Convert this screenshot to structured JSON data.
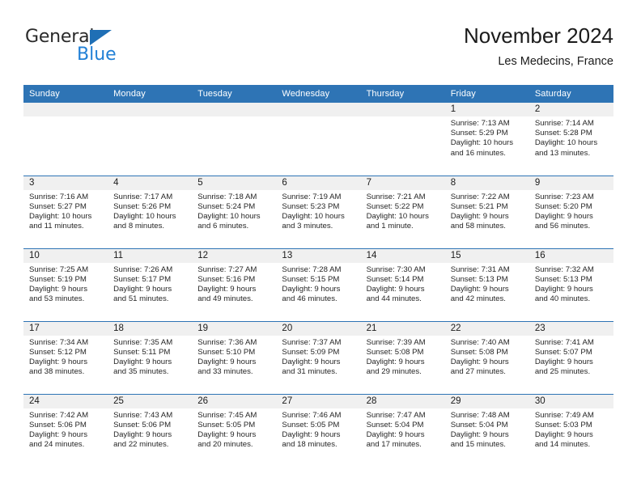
{
  "brand": {
    "name_top": "General",
    "name_bottom": "Blue",
    "triangle_color": "#1f6fb5",
    "blue_text_color": "#2180d6"
  },
  "header": {
    "month_title": "November 2024",
    "location": "Les Medecins, France"
  },
  "theme": {
    "header_blue": "#2e74b5",
    "daynum_band": "#f0f0f0",
    "text": "#262626"
  },
  "weekday_headers": [
    "Sunday",
    "Monday",
    "Tuesday",
    "Wednesday",
    "Thursday",
    "Friday",
    "Saturday"
  ],
  "labels": {
    "sunrise_prefix": "Sunrise:",
    "sunset_prefix": "Sunset:",
    "daylight_prefix": "Daylight:"
  },
  "weeks": [
    [
      {
        "day": "",
        "empty": true
      },
      {
        "day": "",
        "empty": true
      },
      {
        "day": "",
        "empty": true
      },
      {
        "day": "",
        "empty": true
      },
      {
        "day": "",
        "empty": true
      },
      {
        "day": "1",
        "sunrise": "Sunrise: 7:13 AM",
        "sunset": "Sunset: 5:29 PM",
        "daylight_line1": "Daylight: 10 hours",
        "daylight_line2": "and 16 minutes."
      },
      {
        "day": "2",
        "sunrise": "Sunrise: 7:14 AM",
        "sunset": "Sunset: 5:28 PM",
        "daylight_line1": "Daylight: 10 hours",
        "daylight_line2": "and 13 minutes."
      }
    ],
    [
      {
        "day": "3",
        "sunrise": "Sunrise: 7:16 AM",
        "sunset": "Sunset: 5:27 PM",
        "daylight_line1": "Daylight: 10 hours",
        "daylight_line2": "and 11 minutes."
      },
      {
        "day": "4",
        "sunrise": "Sunrise: 7:17 AM",
        "sunset": "Sunset: 5:26 PM",
        "daylight_line1": "Daylight: 10 hours",
        "daylight_line2": "and 8 minutes."
      },
      {
        "day": "5",
        "sunrise": "Sunrise: 7:18 AM",
        "sunset": "Sunset: 5:24 PM",
        "daylight_line1": "Daylight: 10 hours",
        "daylight_line2": "and 6 minutes."
      },
      {
        "day": "6",
        "sunrise": "Sunrise: 7:19 AM",
        "sunset": "Sunset: 5:23 PM",
        "daylight_line1": "Daylight: 10 hours",
        "daylight_line2": "and 3 minutes."
      },
      {
        "day": "7",
        "sunrise": "Sunrise: 7:21 AM",
        "sunset": "Sunset: 5:22 PM",
        "daylight_line1": "Daylight: 10 hours",
        "daylight_line2": "and 1 minute."
      },
      {
        "day": "8",
        "sunrise": "Sunrise: 7:22 AM",
        "sunset": "Sunset: 5:21 PM",
        "daylight_line1": "Daylight: 9 hours",
        "daylight_line2": "and 58 minutes."
      },
      {
        "day": "9",
        "sunrise": "Sunrise: 7:23 AM",
        "sunset": "Sunset: 5:20 PM",
        "daylight_line1": "Daylight: 9 hours",
        "daylight_line2": "and 56 minutes."
      }
    ],
    [
      {
        "day": "10",
        "sunrise": "Sunrise: 7:25 AM",
        "sunset": "Sunset: 5:19 PM",
        "daylight_line1": "Daylight: 9 hours",
        "daylight_line2": "and 53 minutes."
      },
      {
        "day": "11",
        "sunrise": "Sunrise: 7:26 AM",
        "sunset": "Sunset: 5:17 PM",
        "daylight_line1": "Daylight: 9 hours",
        "daylight_line2": "and 51 minutes."
      },
      {
        "day": "12",
        "sunrise": "Sunrise: 7:27 AM",
        "sunset": "Sunset: 5:16 PM",
        "daylight_line1": "Daylight: 9 hours",
        "daylight_line2": "and 49 minutes."
      },
      {
        "day": "13",
        "sunrise": "Sunrise: 7:28 AM",
        "sunset": "Sunset: 5:15 PM",
        "daylight_line1": "Daylight: 9 hours",
        "daylight_line2": "and 46 minutes."
      },
      {
        "day": "14",
        "sunrise": "Sunrise: 7:30 AM",
        "sunset": "Sunset: 5:14 PM",
        "daylight_line1": "Daylight: 9 hours",
        "daylight_line2": "and 44 minutes."
      },
      {
        "day": "15",
        "sunrise": "Sunrise: 7:31 AM",
        "sunset": "Sunset: 5:13 PM",
        "daylight_line1": "Daylight: 9 hours",
        "daylight_line2": "and 42 minutes."
      },
      {
        "day": "16",
        "sunrise": "Sunrise: 7:32 AM",
        "sunset": "Sunset: 5:13 PM",
        "daylight_line1": "Daylight: 9 hours",
        "daylight_line2": "and 40 minutes."
      }
    ],
    [
      {
        "day": "17",
        "sunrise": "Sunrise: 7:34 AM",
        "sunset": "Sunset: 5:12 PM",
        "daylight_line1": "Daylight: 9 hours",
        "daylight_line2": "and 38 minutes."
      },
      {
        "day": "18",
        "sunrise": "Sunrise: 7:35 AM",
        "sunset": "Sunset: 5:11 PM",
        "daylight_line1": "Daylight: 9 hours",
        "daylight_line2": "and 35 minutes."
      },
      {
        "day": "19",
        "sunrise": "Sunrise: 7:36 AM",
        "sunset": "Sunset: 5:10 PM",
        "daylight_line1": "Daylight: 9 hours",
        "daylight_line2": "and 33 minutes."
      },
      {
        "day": "20",
        "sunrise": "Sunrise: 7:37 AM",
        "sunset": "Sunset: 5:09 PM",
        "daylight_line1": "Daylight: 9 hours",
        "daylight_line2": "and 31 minutes."
      },
      {
        "day": "21",
        "sunrise": "Sunrise: 7:39 AM",
        "sunset": "Sunset: 5:08 PM",
        "daylight_line1": "Daylight: 9 hours",
        "daylight_line2": "and 29 minutes."
      },
      {
        "day": "22",
        "sunrise": "Sunrise: 7:40 AM",
        "sunset": "Sunset: 5:08 PM",
        "daylight_line1": "Daylight: 9 hours",
        "daylight_line2": "and 27 minutes."
      },
      {
        "day": "23",
        "sunrise": "Sunrise: 7:41 AM",
        "sunset": "Sunset: 5:07 PM",
        "daylight_line1": "Daylight: 9 hours",
        "daylight_line2": "and 25 minutes."
      }
    ],
    [
      {
        "day": "24",
        "sunrise": "Sunrise: 7:42 AM",
        "sunset": "Sunset: 5:06 PM",
        "daylight_line1": "Daylight: 9 hours",
        "daylight_line2": "and 24 minutes."
      },
      {
        "day": "25",
        "sunrise": "Sunrise: 7:43 AM",
        "sunset": "Sunset: 5:06 PM",
        "daylight_line1": "Daylight: 9 hours",
        "daylight_line2": "and 22 minutes."
      },
      {
        "day": "26",
        "sunrise": "Sunrise: 7:45 AM",
        "sunset": "Sunset: 5:05 PM",
        "daylight_line1": "Daylight: 9 hours",
        "daylight_line2": "and 20 minutes."
      },
      {
        "day": "27",
        "sunrise": "Sunrise: 7:46 AM",
        "sunset": "Sunset: 5:05 PM",
        "daylight_line1": "Daylight: 9 hours",
        "daylight_line2": "and 18 minutes."
      },
      {
        "day": "28",
        "sunrise": "Sunrise: 7:47 AM",
        "sunset": "Sunset: 5:04 PM",
        "daylight_line1": "Daylight: 9 hours",
        "daylight_line2": "and 17 minutes."
      },
      {
        "day": "29",
        "sunrise": "Sunrise: 7:48 AM",
        "sunset": "Sunset: 5:04 PM",
        "daylight_line1": "Daylight: 9 hours",
        "daylight_line2": "and 15 minutes."
      },
      {
        "day": "30",
        "sunrise": "Sunrise: 7:49 AM",
        "sunset": "Sunset: 5:03 PM",
        "daylight_line1": "Daylight: 9 hours",
        "daylight_line2": "and 14 minutes."
      }
    ]
  ]
}
